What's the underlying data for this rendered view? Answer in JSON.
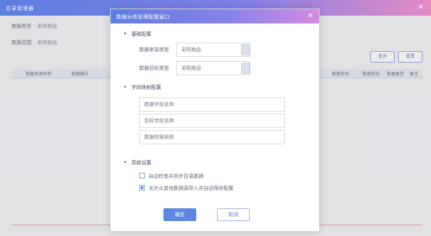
{
  "app": {
    "title": "目录管理器"
  },
  "background": {
    "filters": [
      {
        "label": "数据类型",
        "value": "采购商品"
      },
      {
        "label": "数据范围",
        "value": "采购商品"
      }
    ],
    "buttons": {
      "query": "查询",
      "reset": "重置"
    },
    "table_headers": [
      "数据来源名称",
      "数据编号",
      "数据名称",
      "数据状态",
      "数据类型",
      "备注"
    ]
  },
  "dialog": {
    "title": "数据分类管理配置窗口",
    "sections": {
      "basic": "基础配置",
      "mapping": "字段映射配置",
      "options": "高级设置"
    },
    "basic_fields": [
      {
        "label": "数据来源类型",
        "value": "采购商品"
      },
      {
        "label": "数据目标类型",
        "value": "采购商品"
      }
    ],
    "mapping_fields": [
      {
        "label": "数据字段名称"
      },
      {
        "label": "目标字段名称"
      },
      {
        "label": "数据转换规则"
      }
    ],
    "options": [
      {
        "label": "自动检查并同步目录数据",
        "checked": false
      },
      {
        "label": "允许从其他数据源导入并自动保存配置",
        "checked": true
      }
    ],
    "buttons": {
      "confirm": "确定",
      "cancel": "取消"
    }
  }
}
